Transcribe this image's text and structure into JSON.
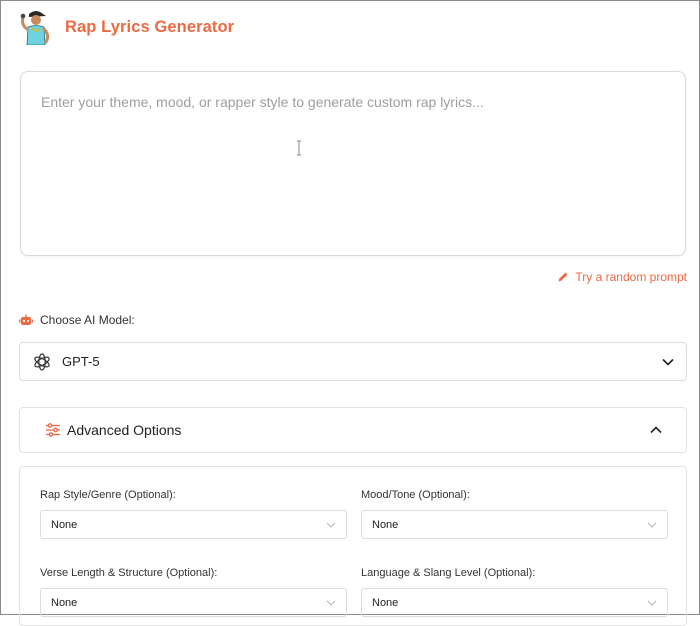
{
  "app": {
    "title": "Rap Lyrics Generator",
    "accent_color": "#ec6a43"
  },
  "prompt": {
    "placeholder": "Enter your theme, mood, or rapper style to generate custom rap lyrics...",
    "value": ""
  },
  "random_prompt": {
    "icon": "pencil-icon",
    "label": "Try a random prompt"
  },
  "model": {
    "label": "Choose AI Model:",
    "label_icon": "robot-icon",
    "selected": "GPT-5",
    "selected_icon": "openai-icon"
  },
  "advanced": {
    "label": "Advanced Options",
    "icon": "sliders-icon",
    "expanded": true,
    "options": [
      {
        "label": "Rap Style/Genre (Optional):",
        "value": "None"
      },
      {
        "label": "Mood/Tone (Optional):",
        "value": "None"
      },
      {
        "label": "Verse Length & Structure (Optional):",
        "value": "None"
      },
      {
        "label": "Language & Slang Level (Optional):",
        "value": "None"
      }
    ]
  }
}
